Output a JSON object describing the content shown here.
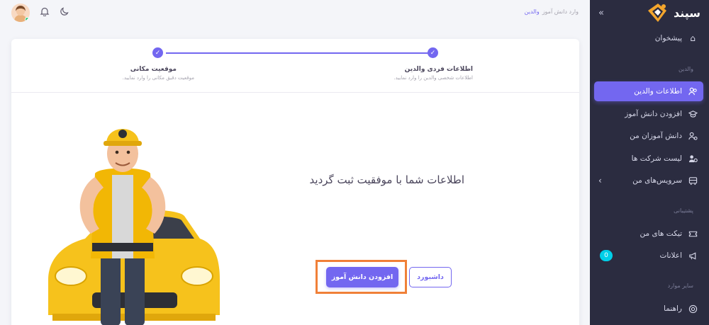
{
  "brand": {
    "name": "سپند"
  },
  "sidebar": {
    "dashboard": {
      "label": "پیشخوان",
      "icon": "home-icon"
    },
    "sections": {
      "parents": "والدین",
      "support": "پشتیبانی",
      "other": "سایر موارد"
    },
    "items": [
      {
        "label": "اطلاعات والدین",
        "icon": "users-icon",
        "active": true
      },
      {
        "label": "افزودن دانش آموز",
        "icon": "graduation-cap-icon"
      },
      {
        "label": "دانش آموزان من",
        "icon": "students-icon"
      },
      {
        "label": "لیست شرکت ها",
        "icon": "company-icon"
      },
      {
        "label": "سرویس‌های من",
        "icon": "bus-icon"
      }
    ],
    "support_items": [
      {
        "label": "تیکت های من",
        "icon": "ticket-icon"
      },
      {
        "label": "اعلانات",
        "icon": "megaphone-icon",
        "badge": "0"
      }
    ],
    "other_items": [
      {
        "label": "راهنما",
        "icon": "lifebuoy-icon"
      }
    ]
  },
  "breadcrumb": {
    "current": "والدین",
    "parent": "وارد دانش آموز"
  },
  "stepper": {
    "steps": [
      {
        "title": "اطلاعات فردی والدین",
        "subtitle": "اطلاعات شخصی والدین را وارد نمایید."
      },
      {
        "title": "موقعیت مکانی",
        "subtitle": "موقعیت دقیق مکانی را وارد نمایید."
      }
    ]
  },
  "main": {
    "success_message": "اطلاعات شما با موفقیت ثبت گردید",
    "add_student_button": "افزودن دانش آموز",
    "dashboard_button": "داشبورد"
  },
  "colors": {
    "accent": "#7367f0",
    "sidebar_bg": "#2b2c40",
    "highlight": "#f08038",
    "badge": "#00cfe8"
  }
}
